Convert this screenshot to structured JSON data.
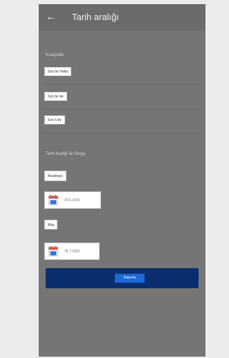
{
  "app_bar": {
    "back_icon": "arrow-left-icon",
    "title": "Tarih aralığı"
  },
  "presets": {
    "label": "Kısayollar",
    "items": [
      "Son bir Hafta",
      "Son bir Ay",
      "Son 6 Ay"
    ]
  },
  "range_query": {
    "label": "Tarih Aralığı ile Sorgu",
    "start_label": "Başlangıç",
    "start_date": "29.6.2020",
    "end_label": "Bitiş",
    "end_date": "28.7.2020",
    "calendar_icon": "calendar-icon"
  },
  "actions": {
    "report_label": "Raporla"
  },
  "colors": {
    "screen_background": "#757575",
    "app_bar": "#6b6b6b",
    "report_button": "#0a2d6e",
    "report_label": "#1e67d6"
  }
}
